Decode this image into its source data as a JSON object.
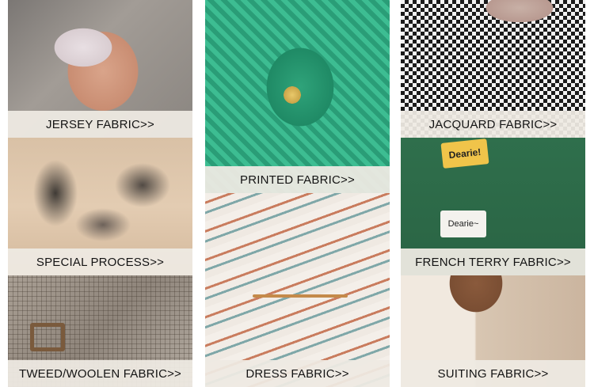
{
  "tiles": {
    "jersey": "JERSEY FABRIC>>",
    "printed": "PRINTED FABRIC>>",
    "jacquard": "JACQUARD FABRIC>>",
    "special": "SPECIAL PROCESS>>",
    "french": "FRENCH TERRY FABRIC>>",
    "tweed": "TWEED/WOOLEN FABRIC>>",
    "dress": "DRESS FABRIC>>",
    "suiting": "SUITING FABRIC>>"
  },
  "badges": {
    "dearie_top": "Dearie!",
    "dearie_bottom": "Dearie~"
  }
}
